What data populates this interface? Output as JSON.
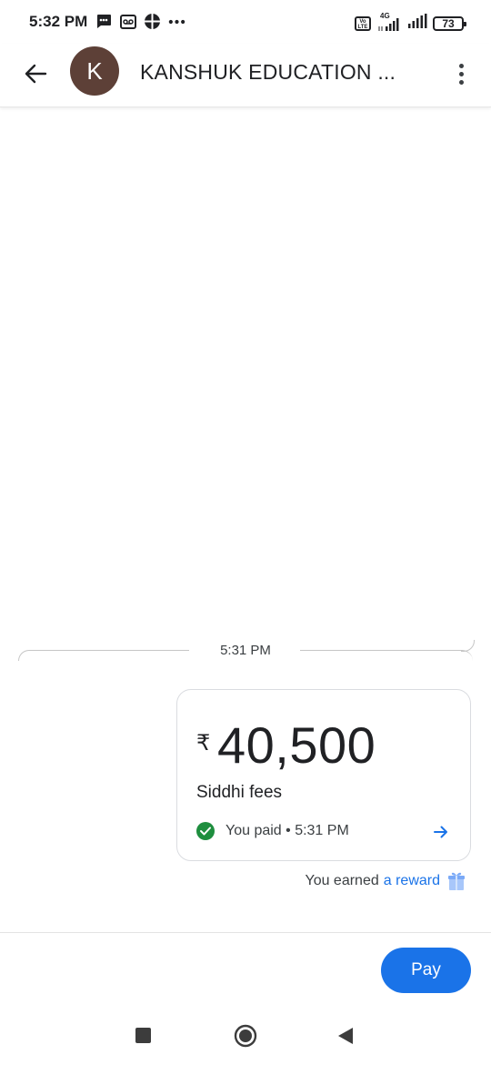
{
  "status_bar": {
    "time": "5:32 PM",
    "network": "4G",
    "battery": "73",
    "volte": "Vo LTE"
  },
  "header": {
    "avatar_letter": "K",
    "avatar_color": "#5d4037",
    "title": "KANSHUK EDUCATION ...",
    "back_icon": "arrow-left-icon",
    "more_icon": "more-vertical-icon"
  },
  "conversation": {
    "timestamp": "5:31 PM",
    "payment": {
      "currency_symbol": "₹",
      "amount": "40,500",
      "note": "Siddhi fees",
      "status": "You paid • 5:31 PM",
      "status_color": "#1e8e3e"
    },
    "reward": {
      "prefix": "You earned",
      "link": "a reward"
    }
  },
  "actions": {
    "pay_label": "Pay",
    "accent": "#1a73e8"
  }
}
